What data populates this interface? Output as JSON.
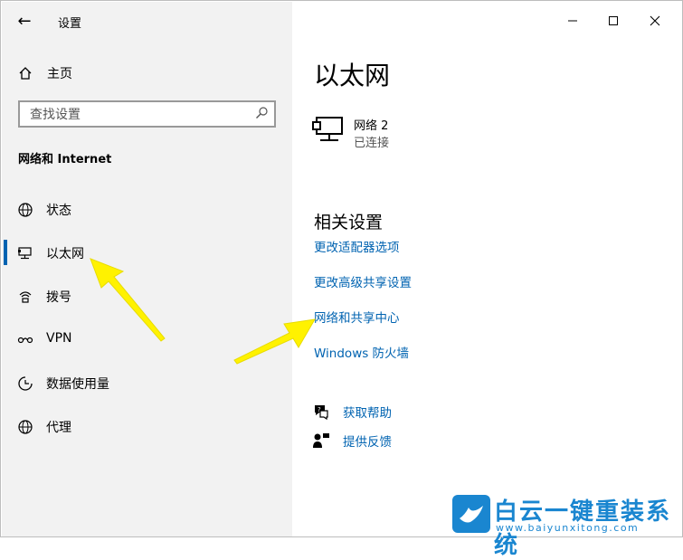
{
  "window": {
    "title": "设置"
  },
  "sidebar": {
    "home_label": "主页",
    "search_placeholder": "查找设置",
    "section_title": "网络和 Internet",
    "items": [
      {
        "label": "状态",
        "icon": "globe-status-icon"
      },
      {
        "label": "以太网",
        "icon": "ethernet-icon",
        "active": true
      },
      {
        "label": "拨号",
        "icon": "dialup-icon"
      },
      {
        "label": "VPN",
        "icon": "vpn-icon"
      },
      {
        "label": "数据使用量",
        "icon": "data-usage-icon"
      },
      {
        "label": "代理",
        "icon": "globe-icon"
      }
    ]
  },
  "main": {
    "title": "以太网",
    "network": {
      "name": "网络 2",
      "status": "已连接"
    },
    "related_title": "相关设置",
    "links": [
      "更改适配器选项",
      "更改高级共享设置",
      "网络和共享中心",
      "Windows 防火墙"
    ],
    "help": [
      {
        "label": "获取帮助",
        "icon": "help-chat-icon"
      },
      {
        "label": "提供反馈",
        "icon": "feedback-icon"
      }
    ]
  },
  "watermark": {
    "title": "白云一键重装系统",
    "url": "www.baiyunxitong.com"
  },
  "colors": {
    "accent": "#0063b1",
    "sidebar_bg": "#f2f2f2",
    "arrow": "#fff200",
    "watermark": "#1a86d0"
  }
}
